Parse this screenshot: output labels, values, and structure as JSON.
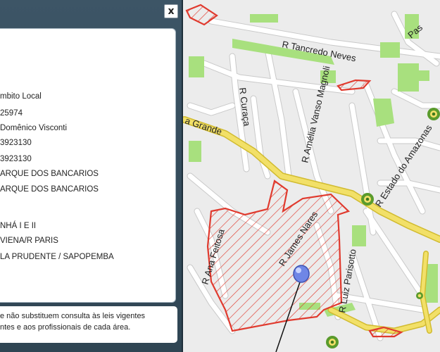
{
  "popup": {
    "close_label": "x",
    "fields": [
      "mbito Local",
      "25974",
      "Domênico Visconti",
      "3923130",
      "3923130",
      "ARQUE DOS BANCARIOS",
      "ARQUE DOS BANCARIOS",
      "NHÁ I E II",
      " VIENA/R PARIS",
      "LA PRUDENTE / SAPOPEMBA"
    ],
    "footer_lines": [
      "e não substituem consulta às leis vigentes",
      "ntes e aos profissionais de cada área."
    ]
  },
  "map": {
    "streets": {
      "tancredo": "R Tancredo Neves",
      "vanso": "R Amélia Vanso Magnoli",
      "curaca": "R Curaça",
      "grande": "a Grande",
      "estado": "R Estado do Amazonas",
      "nares": "R James Nares",
      "feitosa": "R Ana Feitosa",
      "parisotto": "R Luiz Parisotto",
      "pas": "Pas"
    },
    "colors": {
      "background": "#ececec",
      "block": "#ffffff",
      "park": "#a8e07e",
      "main_road": "#f2e068",
      "zone_stroke": "#e03a2e",
      "marker": "#6f86e6"
    }
  }
}
